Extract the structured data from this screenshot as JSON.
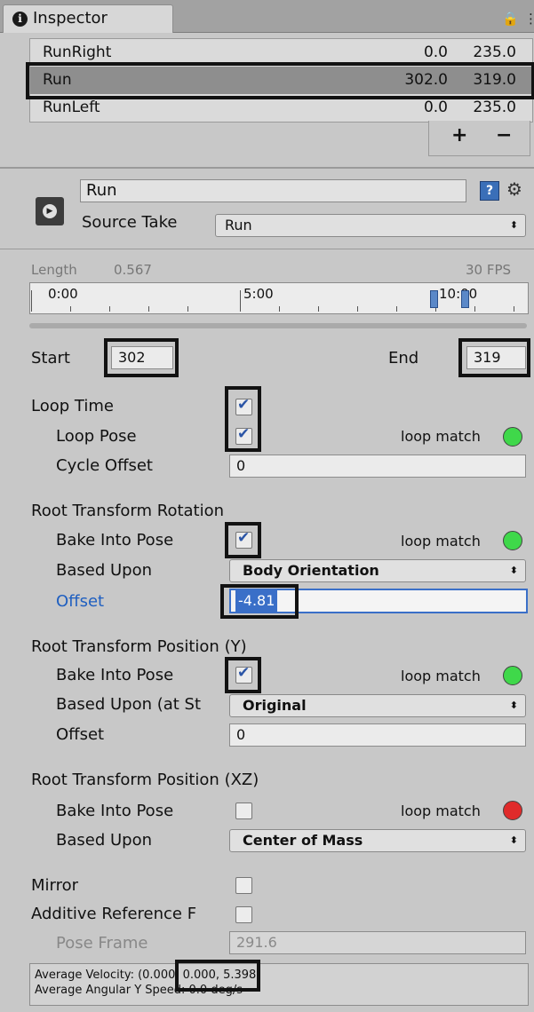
{
  "tab": {
    "title": "Inspector",
    "info_icon": "info-icon",
    "lock_icon": "lock-icon"
  },
  "clips": [
    {
      "name": "RunRight",
      "start": "0.0",
      "end": "235.0"
    },
    {
      "name": "Run",
      "start": "302.0",
      "end": "319.0"
    },
    {
      "name": "RunLeft",
      "start": "0.0",
      "end": "235.0"
    }
  ],
  "clip_buttons": {
    "add": "+",
    "remove": "−"
  },
  "clip": {
    "name": "Run",
    "source_take_label": "Source Take",
    "source_take_value": "Run",
    "help_icon": "?",
    "gear_icon": "⚙"
  },
  "timeline": {
    "length_label": "Length",
    "length_value": "0.567",
    "fps": "30 FPS",
    "ticks": [
      "0:00",
      "5:00",
      "10:00"
    ]
  },
  "range": {
    "start_label": "Start",
    "start_value": "302",
    "end_label": "End",
    "end_value": "319"
  },
  "loop": {
    "time_label": "Loop Time",
    "time_checked": true,
    "pose_label": "Loop Pose",
    "pose_checked": true,
    "pose_match": "loop match",
    "pose_match_color": "#3fd84a",
    "cycle_label": "Cycle Offset",
    "cycle_value": "0"
  },
  "rotation": {
    "header": "Root Transform Rotation",
    "bake_label": "Bake Into Pose",
    "bake_checked": true,
    "match": "loop match",
    "match_color": "#3fd84a",
    "based_label": "Based Upon",
    "based_value": "Body Orientation",
    "offset_label": "Offset",
    "offset_value": "-4.81"
  },
  "position_y": {
    "header": "Root Transform Position (Y)",
    "bake_label": "Bake Into Pose",
    "bake_checked": true,
    "match": "loop match",
    "match_color": "#3fd84a",
    "based_label": "Based Upon (at St",
    "based_value": "Original",
    "offset_label": "Offset",
    "offset_value": "0"
  },
  "position_xz": {
    "header": "Root Transform Position (XZ)",
    "bake_label": "Bake Into Pose",
    "bake_checked": false,
    "match": "loop match",
    "match_color": "#e02b2b",
    "based_label": "Based Upon",
    "based_value": "Center of Mass"
  },
  "mirror": {
    "label": "Mirror",
    "checked": false
  },
  "additive": {
    "label": "Additive Reference F",
    "checked": false,
    "pose_frame_label": "Pose Frame",
    "pose_frame_value": "291.6"
  },
  "info": {
    "velocity": "Average Velocity: (0.000, 0.000, 5.398)",
    "angular": "Average Angular Y Speed: 0.0 deg/s"
  }
}
